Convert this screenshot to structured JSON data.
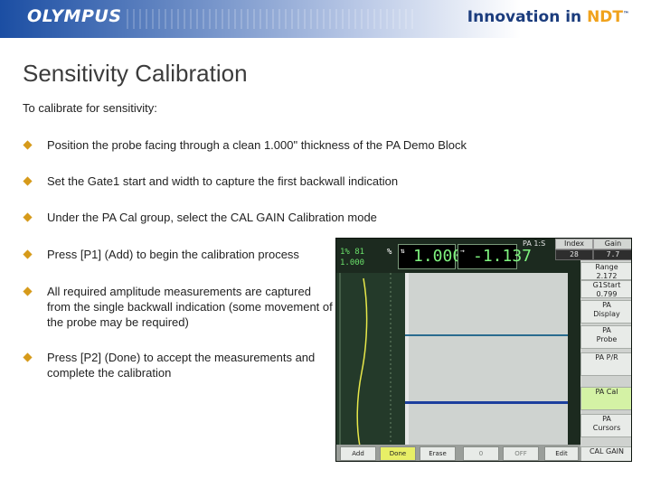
{
  "banner": {
    "logo": "OLYMPUS",
    "tagline_prefix": "Innovation in ",
    "tagline_highlight": "NDT",
    "tagline_tm": "™",
    "colors": {
      "brand_blue": "#1b4ea3",
      "ndt_orange": "#f0a21c"
    }
  },
  "page": {
    "title": "Sensitivity Calibration",
    "intro": "To calibrate for sensitivity:",
    "bullets": [
      "Position the probe facing through a clean 1.000\" thickness of the PA Demo Block",
      "Set the Gate1 start and width to capture the first backwall indication",
      "Under the PA Cal group, select the CAL GAIN Calibration mode",
      "Press [P1] (Add) to begin the calibration process",
      "All required amplitude measurements are captured from the single backwall indication (some movement of the probe may be required)",
      "Press [P2] (Done) to accept the measurements and complete the calibration"
    ],
    "bullet_color": "#d69a1a"
  },
  "device": {
    "amp_top": "1% 81",
    "amp_bottom": "1.000",
    "pct": "%",
    "reading_1": "1.000",
    "reading_2": "-1.137",
    "pa_label": "PA 1:S",
    "header": {
      "index_label": "Index",
      "index_value": "28",
      "gain_label": "Gain",
      "gain_value": "7.7"
    },
    "side_items": [
      {
        "l1": "Range",
        "l2": "2.172"
      },
      {
        "l1": "G1Start",
        "l2": "0.799"
      },
      {
        "l1": "PA",
        "l2": "Display"
      },
      {
        "l1": "PA",
        "l2": "Probe"
      },
      {
        "l1": "PA P/R",
        "l2": ""
      },
      {
        "l1": "PA Cal",
        "l2": ""
      },
      {
        "l1": "PA",
        "l2": "Cursors"
      },
      {
        "l1": "CAL GAIN",
        "l2": ""
      }
    ],
    "softkeys": [
      "Add",
      "Done",
      "Erase",
      "0",
      "OFF",
      "Edit"
    ],
    "colors": {
      "echo_1": "#2a6b8f",
      "echo_2": "#1c3f9e",
      "highlight": "#e8ef66"
    }
  }
}
